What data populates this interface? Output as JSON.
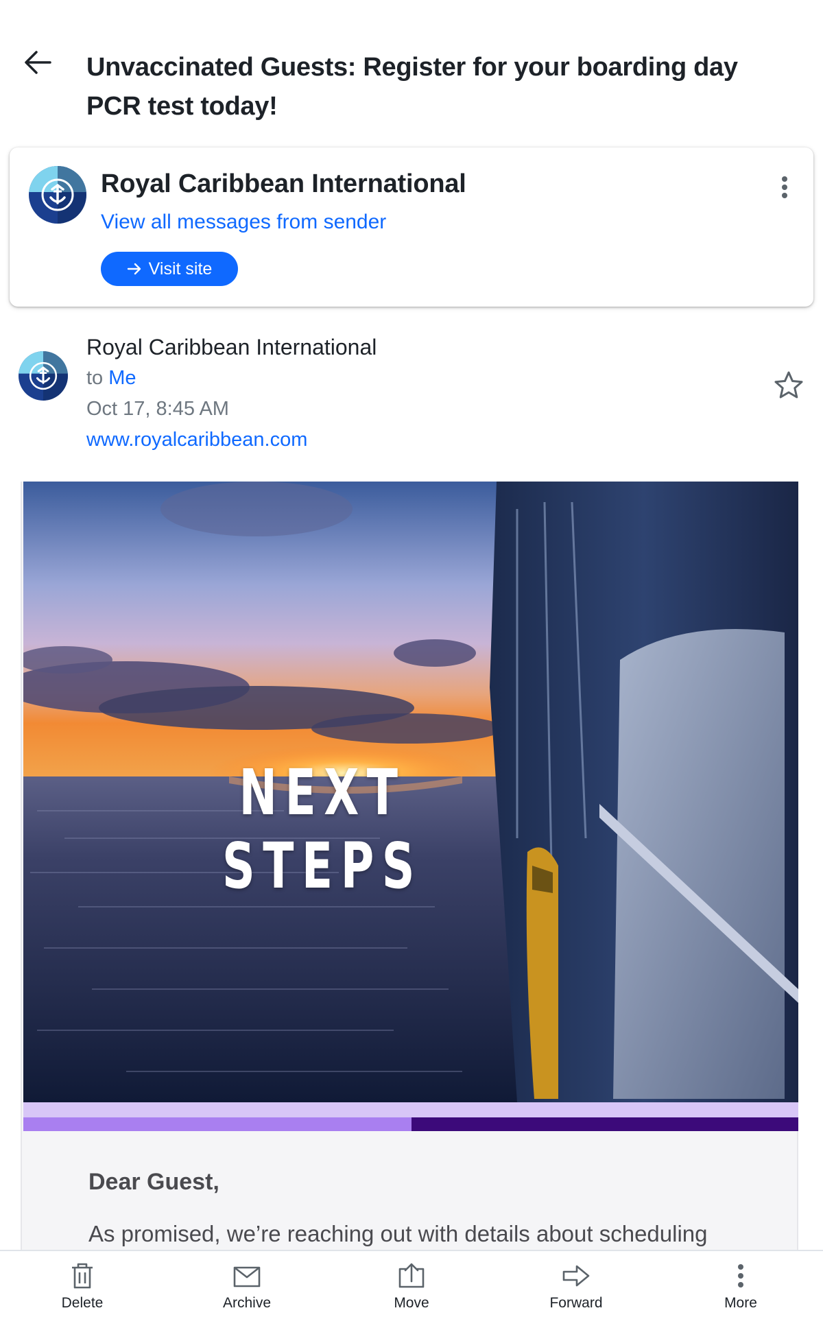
{
  "header": {
    "subject": "Unvaccinated Guests: Register for your boarding day PCR test today!"
  },
  "sender_card": {
    "name": "Royal Caribbean International",
    "view_all_link": "View all messages from sender",
    "visit_site_label": "Visit site"
  },
  "message": {
    "from": "Royal Caribbean International",
    "to_prefix": "to",
    "to_name": "Me",
    "date": "Oct 17, 8:45 AM",
    "website": "www.royalcaribbean.com"
  },
  "body": {
    "hero_text": "NEXT STEPS",
    "greeting": "Dear Guest,",
    "paragraph": "As promised, we’re reaching out with details about scheduling"
  },
  "bottom_bar": {
    "items": [
      {
        "label": "Delete",
        "icon": "trash-icon"
      },
      {
        "label": "Archive",
        "icon": "archive-icon"
      },
      {
        "label": "Move",
        "icon": "move-icon"
      },
      {
        "label": "Forward",
        "icon": "forward-icon"
      },
      {
        "label": "More",
        "icon": "more-vertical-icon"
      }
    ]
  },
  "colors": {
    "link_blue": "#0f69ff",
    "band_light": "#a97ff0",
    "band_dark": "#3c0a7a",
    "band_top": "#d8c6f7"
  }
}
